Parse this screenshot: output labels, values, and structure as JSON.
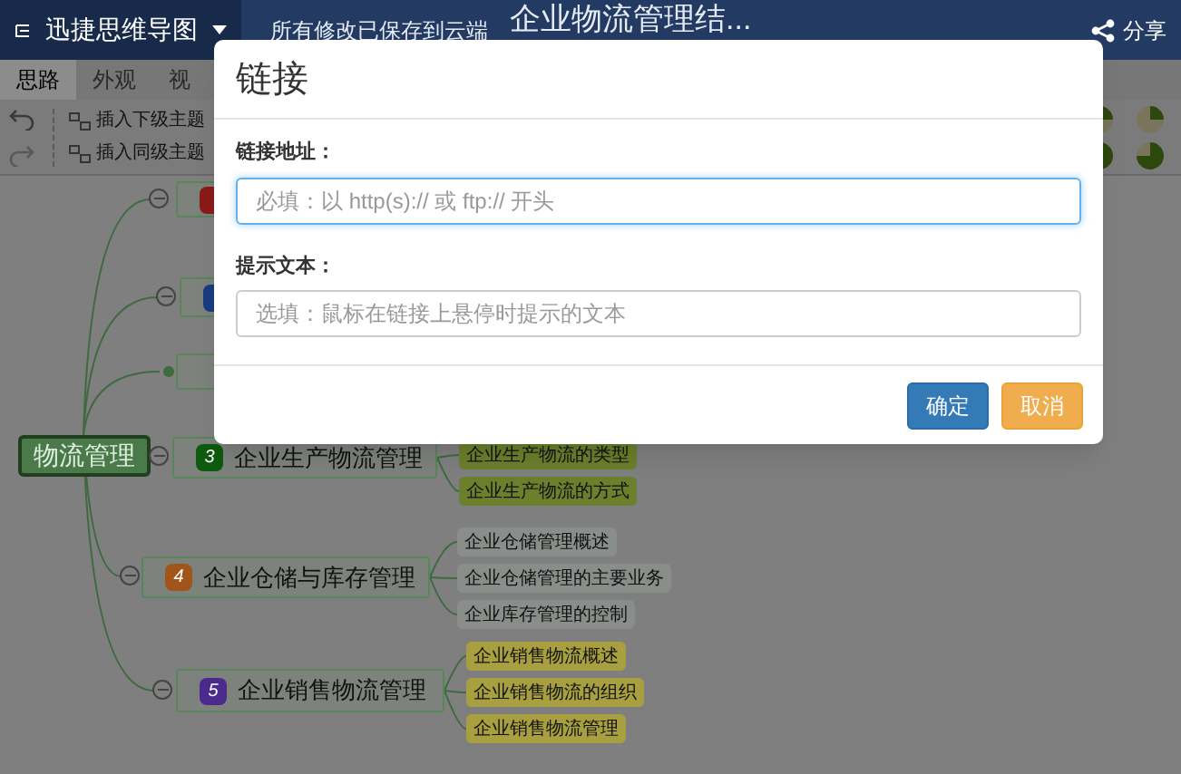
{
  "app": {
    "name": "迅捷思维导图",
    "save_status": "所有修改已保存到云端",
    "document_title": "企业物流管理结...",
    "share": "分享"
  },
  "tabs": [
    {
      "label": "思路",
      "selected": true
    },
    {
      "label": "外观",
      "selected": false
    },
    {
      "label": "视",
      "selected": false
    }
  ],
  "toolbar": [
    "插入下级主题",
    "插入同级主题"
  ],
  "mind_map": {
    "root": "物流管理",
    "branches": [
      {
        "color": "#8b1a1a",
        "collapsed": false
      },
      {
        "color": "#1a3c80",
        "collapsed": false
      },
      {
        "collapsed": true
      },
      {
        "number": "3",
        "color": "#0e5a0e",
        "title": "企业生产物流管理",
        "collapsed": false,
        "children": [
          {
            "text": "企业生产物流的类型",
            "color": "#6b7f2c"
          },
          {
            "text": "企业生产物流的方式",
            "color": "#6b7f2c"
          }
        ]
      },
      {
        "number": "4",
        "color": "#a0561a",
        "title": "企业仓储与库存管理",
        "collapsed": false,
        "children": [
          {
            "text": "企业仓储管理概述",
            "color": "#8a8e8a"
          },
          {
            "text": "企业仓储管理的主要业务",
            "color": "#8a8e8a"
          },
          {
            "text": "企业库存管理的控制",
            "color": "#8a8e8a"
          }
        ]
      },
      {
        "number": "5",
        "color": "#4a2a8a",
        "title": "企业销售物流管理",
        "collapsed": false,
        "children": [
          {
            "text": "企业销售物流概述",
            "color": "#a8a040"
          },
          {
            "text": "企业销售物流的组织",
            "color": "#a8a040"
          },
          {
            "text": "企业销售物流管理",
            "color": "#a8a040"
          }
        ]
      }
    ]
  },
  "dialog": {
    "title": "链接",
    "fields": [
      {
        "label": "链接地址：",
        "placeholder": "必填：以 http(s):// 或 ftp:// 开头",
        "focused": true
      },
      {
        "label": "提示文本：",
        "placeholder": "选填：鼠标在链接上悬停时提示的文本",
        "focused": false
      }
    ],
    "buttons": [
      {
        "label": "确定",
        "kind": "primary"
      },
      {
        "label": "取消",
        "kind": "cancel"
      }
    ]
  }
}
